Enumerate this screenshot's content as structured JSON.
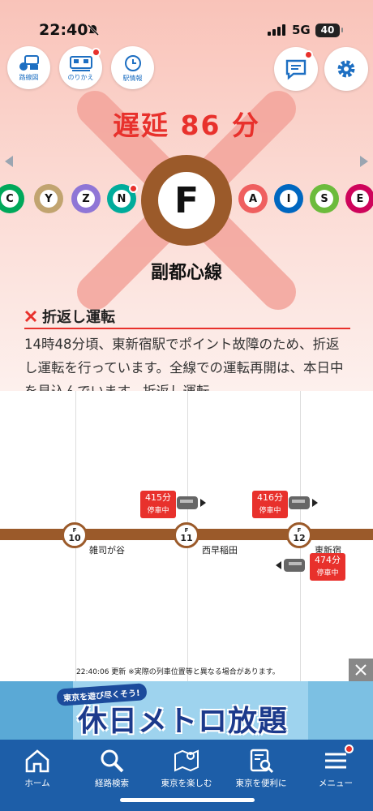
{
  "status": {
    "time": "22:40",
    "network": "5G",
    "battery": "40"
  },
  "header": {
    "buttons": [
      {
        "label": "路線図"
      },
      {
        "label": "のりかえ"
      },
      {
        "label": "駅情報"
      }
    ]
  },
  "delay": {
    "text": "遅延 86 分"
  },
  "lines": {
    "left": [
      "C",
      "Y",
      "Z",
      "N"
    ],
    "main": "F",
    "right": [
      "A",
      "I",
      "S",
      "E"
    ],
    "colors": {
      "C": "#00a85a",
      "Y": "#c1a470",
      "Z": "#8f76d6",
      "N": "#00ac9b",
      "F": "#9b5a2a",
      "A": "#ef5f5f",
      "I": "#0067c0",
      "S": "#6cbb3c",
      "E": "#ce045b"
    }
  },
  "line_name": "副都心線",
  "notice": {
    "title": "折返し運転",
    "body": "14時48分頃、東新宿駅でポイント故障のため、折返し運転を行っています。全線での運転再開は、本日中を見込んでいます。折返し運転"
  },
  "map": {
    "stations": [
      {
        "line": "F",
        "num": "10",
        "name": "雑司が谷"
      },
      {
        "line": "F",
        "num": "11",
        "name": "西早稲田"
      },
      {
        "line": "F",
        "num": "12",
        "name": "東新宿"
      }
    ],
    "trains": [
      {
        "delay": "415分",
        "state": "停車中"
      },
      {
        "delay": "416分",
        "state": "停車中"
      },
      {
        "delay": "474分",
        "state": "停車中"
      }
    ],
    "update_time": "22:40:06",
    "update_note": "更新 ※実際の列車位置等と異なる場合があります。"
  },
  "banner": {
    "small": "東京を遊び尽くそう!",
    "big": "休日メトロ放題"
  },
  "nav": [
    {
      "label": "ホーム"
    },
    {
      "label": "経路検索"
    },
    {
      "label": "東京を楽しむ"
    },
    {
      "label": "東京を便利に"
    },
    {
      "label": "メニュー"
    }
  ]
}
